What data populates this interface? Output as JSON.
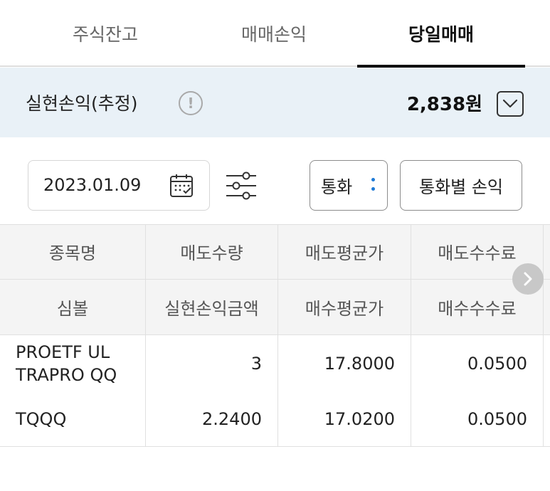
{
  "tabs": [
    {
      "label": "주식잔고",
      "active": false
    },
    {
      "label": "매매손익",
      "active": false
    },
    {
      "label": "당일매매",
      "active": true
    }
  ],
  "realized_pl": {
    "label": "실현손익(추정)",
    "info_icon": "info-circle-icon",
    "amount": "2,838원",
    "dropdown_icon": "chevron-down-icon"
  },
  "filters": {
    "date": "2023.01.09",
    "calendar_icon": "calendar-icon",
    "filter_icon": "sliders-icon",
    "currency_select": "통화",
    "pl_by_currency_button": "통화별 손익"
  },
  "table": {
    "header_row1": [
      "종목명",
      "매도수량",
      "매도평균가",
      "매도수수료"
    ],
    "header_row2": [
      "심볼",
      "실현손익금액",
      "매수평균가",
      "매수수수료"
    ],
    "rows": [
      {
        "col1": "PROETF UL TRAPRO QQ",
        "col2": "3",
        "col3": "17.8000",
        "col4": "0.0500"
      },
      {
        "col1": "TQQQ",
        "col2": "2.2400",
        "col3": "17.0200",
        "col4": "0.0500"
      }
    ],
    "scroll_icon": "chevron-right-icon"
  },
  "colors": {
    "accent_blue": "#1e7ad6",
    "band_bg": "#e9f1f7",
    "header_bg": "#f4f4f4"
  }
}
